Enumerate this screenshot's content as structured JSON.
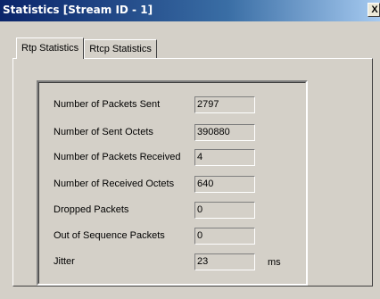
{
  "window": {
    "title": "Statistics [Stream ID - 1]",
    "close_label": "X"
  },
  "tabs": [
    {
      "label": "Rtp Statistics",
      "active": true
    },
    {
      "label": "Rtcp Statistics",
      "active": false
    }
  ],
  "stats": [
    {
      "label": "Number of Packets Sent",
      "value": "2797",
      "unit": ""
    },
    {
      "label": "Number of Sent Octets",
      "value": "390880",
      "unit": ""
    },
    {
      "label": "Number of Packets Received",
      "value": "4",
      "unit": ""
    },
    {
      "label": "Number of Received Octets",
      "value": "640",
      "unit": ""
    },
    {
      "label": "Dropped Packets",
      "value": "0",
      "unit": ""
    },
    {
      "label": "Out of Sequence Packets",
      "value": "0",
      "unit": ""
    },
    {
      "label": "Jitter",
      "value": "23",
      "unit": "ms"
    }
  ]
}
